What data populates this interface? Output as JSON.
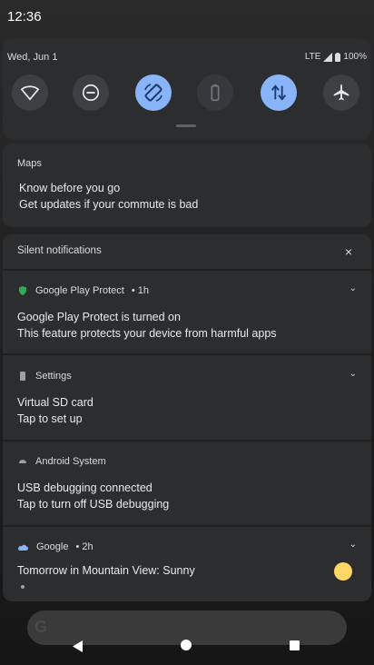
{
  "status_bar": {
    "time": "12:36"
  },
  "quick_settings": {
    "date": "Wed, Jun 1",
    "network": "LTE",
    "battery": "100%",
    "tiles": [
      {
        "name": "wifi",
        "icon": "wifi-icon",
        "state": "off"
      },
      {
        "name": "do-not-disturb",
        "icon": "do-not-disturb-icon",
        "state": "off"
      },
      {
        "name": "auto-rotate",
        "icon": "auto-rotate-icon",
        "state": "on"
      },
      {
        "name": "battery-saver",
        "icon": "battery-saver-icon",
        "state": "disabled"
      },
      {
        "name": "mobile-data",
        "icon": "mobile-data-icon",
        "state": "on"
      },
      {
        "name": "airplane-mode",
        "icon": "airplane-icon",
        "state": "off"
      }
    ]
  },
  "maps_notification": {
    "app": "Maps",
    "title": "Know before you go",
    "text": "Get updates if your commute is bad"
  },
  "silent_section": {
    "header": "Silent notifications",
    "close": "×",
    "notifications": [
      {
        "app": "Google Play Protect",
        "time": "• 1h",
        "title": "Google Play Protect is turned on",
        "text": "This feature protects your device from harmful apps"
      },
      {
        "app": "Settings",
        "time": "",
        "title": "Virtual SD card",
        "text": "Tap to set up"
      },
      {
        "app": "Android System",
        "time": "",
        "title": "USB debugging connected",
        "text": "Tap to turn off USB debugging"
      },
      {
        "app": "Google",
        "time": "• 2h",
        "title": "Tomorrow in Mountain View: Sunny",
        "text": ""
      }
    ]
  },
  "colors": {
    "accent": "#8ab4f8",
    "surface": "#2b2d2f",
    "tile_off": "#3c4043"
  }
}
